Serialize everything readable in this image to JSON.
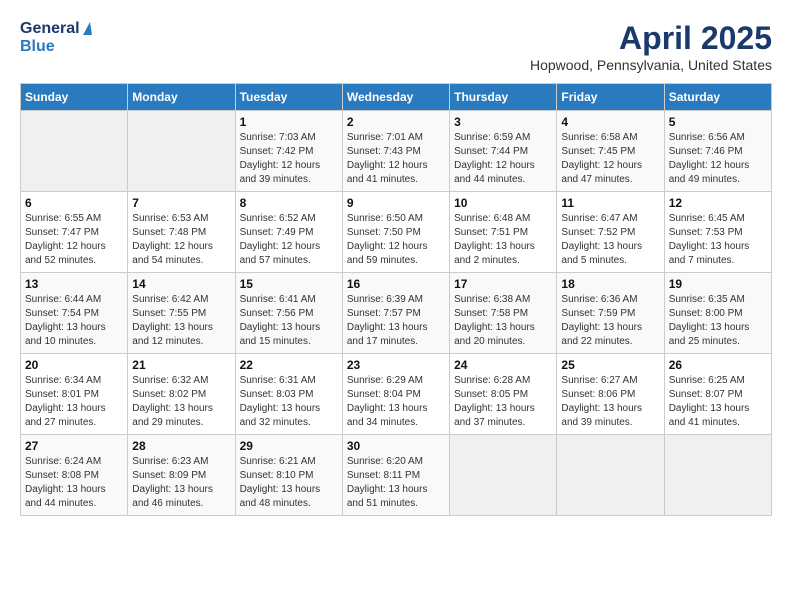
{
  "header": {
    "logo_general": "General",
    "logo_blue": "Blue",
    "title": "April 2025",
    "location": "Hopwood, Pennsylvania, United States"
  },
  "days_of_week": [
    "Sunday",
    "Monday",
    "Tuesday",
    "Wednesday",
    "Thursday",
    "Friday",
    "Saturday"
  ],
  "weeks": [
    [
      {
        "day": "",
        "sunrise": "",
        "sunset": "",
        "daylight": ""
      },
      {
        "day": "",
        "sunrise": "",
        "sunset": "",
        "daylight": ""
      },
      {
        "day": "1",
        "sunrise": "Sunrise: 7:03 AM",
        "sunset": "Sunset: 7:42 PM",
        "daylight": "Daylight: 12 hours and 39 minutes."
      },
      {
        "day": "2",
        "sunrise": "Sunrise: 7:01 AM",
        "sunset": "Sunset: 7:43 PM",
        "daylight": "Daylight: 12 hours and 41 minutes."
      },
      {
        "day": "3",
        "sunrise": "Sunrise: 6:59 AM",
        "sunset": "Sunset: 7:44 PM",
        "daylight": "Daylight: 12 hours and 44 minutes."
      },
      {
        "day": "4",
        "sunrise": "Sunrise: 6:58 AM",
        "sunset": "Sunset: 7:45 PM",
        "daylight": "Daylight: 12 hours and 47 minutes."
      },
      {
        "day": "5",
        "sunrise": "Sunrise: 6:56 AM",
        "sunset": "Sunset: 7:46 PM",
        "daylight": "Daylight: 12 hours and 49 minutes."
      }
    ],
    [
      {
        "day": "6",
        "sunrise": "Sunrise: 6:55 AM",
        "sunset": "Sunset: 7:47 PM",
        "daylight": "Daylight: 12 hours and 52 minutes."
      },
      {
        "day": "7",
        "sunrise": "Sunrise: 6:53 AM",
        "sunset": "Sunset: 7:48 PM",
        "daylight": "Daylight: 12 hours and 54 minutes."
      },
      {
        "day": "8",
        "sunrise": "Sunrise: 6:52 AM",
        "sunset": "Sunset: 7:49 PM",
        "daylight": "Daylight: 12 hours and 57 minutes."
      },
      {
        "day": "9",
        "sunrise": "Sunrise: 6:50 AM",
        "sunset": "Sunset: 7:50 PM",
        "daylight": "Daylight: 12 hours and 59 minutes."
      },
      {
        "day": "10",
        "sunrise": "Sunrise: 6:48 AM",
        "sunset": "Sunset: 7:51 PM",
        "daylight": "Daylight: 13 hours and 2 minutes."
      },
      {
        "day": "11",
        "sunrise": "Sunrise: 6:47 AM",
        "sunset": "Sunset: 7:52 PM",
        "daylight": "Daylight: 13 hours and 5 minutes."
      },
      {
        "day": "12",
        "sunrise": "Sunrise: 6:45 AM",
        "sunset": "Sunset: 7:53 PM",
        "daylight": "Daylight: 13 hours and 7 minutes."
      }
    ],
    [
      {
        "day": "13",
        "sunrise": "Sunrise: 6:44 AM",
        "sunset": "Sunset: 7:54 PM",
        "daylight": "Daylight: 13 hours and 10 minutes."
      },
      {
        "day": "14",
        "sunrise": "Sunrise: 6:42 AM",
        "sunset": "Sunset: 7:55 PM",
        "daylight": "Daylight: 13 hours and 12 minutes."
      },
      {
        "day": "15",
        "sunrise": "Sunrise: 6:41 AM",
        "sunset": "Sunset: 7:56 PM",
        "daylight": "Daylight: 13 hours and 15 minutes."
      },
      {
        "day": "16",
        "sunrise": "Sunrise: 6:39 AM",
        "sunset": "Sunset: 7:57 PM",
        "daylight": "Daylight: 13 hours and 17 minutes."
      },
      {
        "day": "17",
        "sunrise": "Sunrise: 6:38 AM",
        "sunset": "Sunset: 7:58 PM",
        "daylight": "Daylight: 13 hours and 20 minutes."
      },
      {
        "day": "18",
        "sunrise": "Sunrise: 6:36 AM",
        "sunset": "Sunset: 7:59 PM",
        "daylight": "Daylight: 13 hours and 22 minutes."
      },
      {
        "day": "19",
        "sunrise": "Sunrise: 6:35 AM",
        "sunset": "Sunset: 8:00 PM",
        "daylight": "Daylight: 13 hours and 25 minutes."
      }
    ],
    [
      {
        "day": "20",
        "sunrise": "Sunrise: 6:34 AM",
        "sunset": "Sunset: 8:01 PM",
        "daylight": "Daylight: 13 hours and 27 minutes."
      },
      {
        "day": "21",
        "sunrise": "Sunrise: 6:32 AM",
        "sunset": "Sunset: 8:02 PM",
        "daylight": "Daylight: 13 hours and 29 minutes."
      },
      {
        "day": "22",
        "sunrise": "Sunrise: 6:31 AM",
        "sunset": "Sunset: 8:03 PM",
        "daylight": "Daylight: 13 hours and 32 minutes."
      },
      {
        "day": "23",
        "sunrise": "Sunrise: 6:29 AM",
        "sunset": "Sunset: 8:04 PM",
        "daylight": "Daylight: 13 hours and 34 minutes."
      },
      {
        "day": "24",
        "sunrise": "Sunrise: 6:28 AM",
        "sunset": "Sunset: 8:05 PM",
        "daylight": "Daylight: 13 hours and 37 minutes."
      },
      {
        "day": "25",
        "sunrise": "Sunrise: 6:27 AM",
        "sunset": "Sunset: 8:06 PM",
        "daylight": "Daylight: 13 hours and 39 minutes."
      },
      {
        "day": "26",
        "sunrise": "Sunrise: 6:25 AM",
        "sunset": "Sunset: 8:07 PM",
        "daylight": "Daylight: 13 hours and 41 minutes."
      }
    ],
    [
      {
        "day": "27",
        "sunrise": "Sunrise: 6:24 AM",
        "sunset": "Sunset: 8:08 PM",
        "daylight": "Daylight: 13 hours and 44 minutes."
      },
      {
        "day": "28",
        "sunrise": "Sunrise: 6:23 AM",
        "sunset": "Sunset: 8:09 PM",
        "daylight": "Daylight: 13 hours and 46 minutes."
      },
      {
        "day": "29",
        "sunrise": "Sunrise: 6:21 AM",
        "sunset": "Sunset: 8:10 PM",
        "daylight": "Daylight: 13 hours and 48 minutes."
      },
      {
        "day": "30",
        "sunrise": "Sunrise: 6:20 AM",
        "sunset": "Sunset: 8:11 PM",
        "daylight": "Daylight: 13 hours and 51 minutes."
      },
      {
        "day": "",
        "sunrise": "",
        "sunset": "",
        "daylight": ""
      },
      {
        "day": "",
        "sunrise": "",
        "sunset": "",
        "daylight": ""
      },
      {
        "day": "",
        "sunrise": "",
        "sunset": "",
        "daylight": ""
      }
    ]
  ]
}
